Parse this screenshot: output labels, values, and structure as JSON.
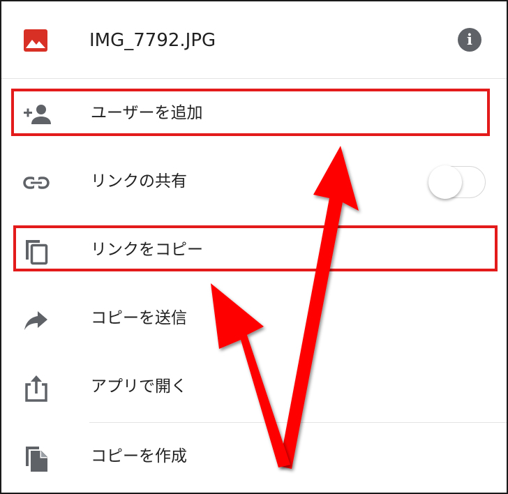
{
  "header": {
    "file_icon": "image-icon",
    "file_name": "IMG_7792.JPG",
    "info_icon": "info-icon",
    "info_glyph": "i"
  },
  "menu": {
    "items": [
      {
        "label": "ユーザーを追加",
        "icon": "person-add-icon"
      },
      {
        "label": "リンクの共有",
        "icon": "link-icon"
      },
      {
        "label": "リンクをコピー",
        "icon": "copy-icon"
      },
      {
        "label": "コピーを送信",
        "icon": "forward-icon"
      },
      {
        "label": "アプリで開く",
        "icon": "open-in-app-icon"
      },
      {
        "label": "コピーを作成",
        "icon": "make-copy-icon"
      }
    ],
    "link_sharing_enabled": false
  },
  "annotations": {
    "highlight_color": "#e31b1b",
    "highlighted_items": [
      "ユーザーを追加",
      "リンクをコピー"
    ]
  },
  "colors": {
    "file_icon_red": "#d93025",
    "icon_gray": "#5f6368",
    "text": "#212121",
    "divider": "#e3e3e3"
  }
}
